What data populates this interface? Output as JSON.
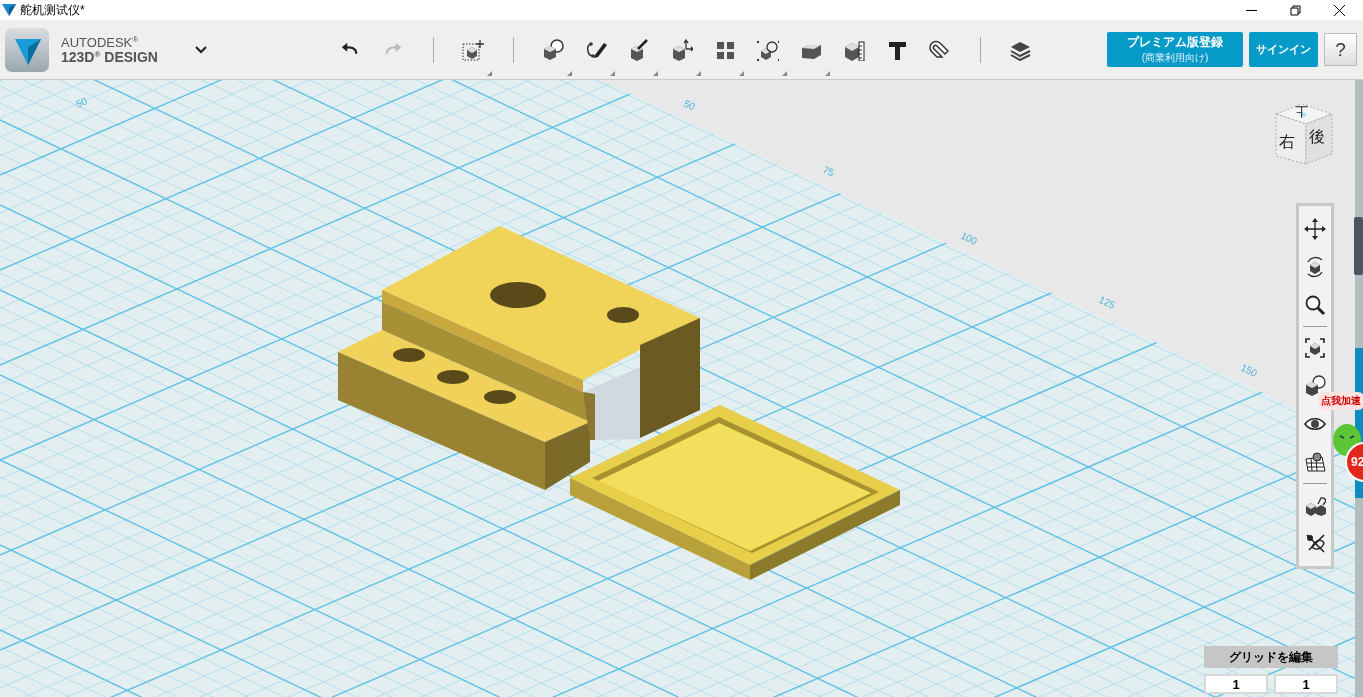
{
  "window": {
    "title": "舵机测试仪*"
  },
  "brand": {
    "line1": "AUTODESK$^{®}$",
    "line2": "123D$^{®}$ DESIGN"
  },
  "toolbar": {
    "history": [
      {
        "kind": "undo",
        "disabled": false
      },
      {
        "kind": "redo",
        "disabled": true
      }
    ],
    "tools": [
      {
        "kind": "transform",
        "has_menu": true
      },
      {
        "kind": "primitives",
        "has_menu": true
      },
      {
        "kind": "sketch",
        "has_menu": true
      },
      {
        "kind": "construct",
        "has_menu": true
      },
      {
        "kind": "modify",
        "has_menu": true
      },
      {
        "kind": "pattern",
        "has_menu": true
      },
      {
        "kind": "group",
        "has_menu": true
      },
      {
        "kind": "combine",
        "has_menu": true
      },
      {
        "kind": "measure",
        "has_menu": false
      },
      {
        "kind": "text",
        "has_menu": false
      },
      {
        "kind": "snap",
        "has_menu": false
      },
      {
        "kind": "material",
        "has_menu": false
      }
    ]
  },
  "premium_button": {
    "label": "プレミアム版登録",
    "sublabel": "(商業利用向け)"
  },
  "signin_button": {
    "label": "サインイン"
  },
  "help_button": {
    "label": "?"
  },
  "view_cube": {
    "top": "上",
    "left": "右",
    "right": "後"
  },
  "grid_labels": [
    "50",
    "50",
    "75",
    "100",
    "125",
    "150"
  ],
  "nav_tools": [
    {
      "kind": "pan"
    },
    {
      "kind": "orbit"
    },
    {
      "kind": "zoom"
    },
    {
      "kind": "separator"
    },
    {
      "kind": "fit"
    },
    {
      "kind": "view"
    },
    {
      "kind": "visibility"
    },
    {
      "kind": "grid"
    },
    {
      "kind": "separator"
    },
    {
      "kind": "snap"
    },
    {
      "kind": "material"
    }
  ],
  "grid_editor": {
    "label": "グリッドを編集",
    "fields": [
      {
        "value": "1"
      },
      {
        "value": "1"
      }
    ]
  },
  "overlay_widget": {
    "bubble": "点我加速",
    "badge": "92"
  }
}
